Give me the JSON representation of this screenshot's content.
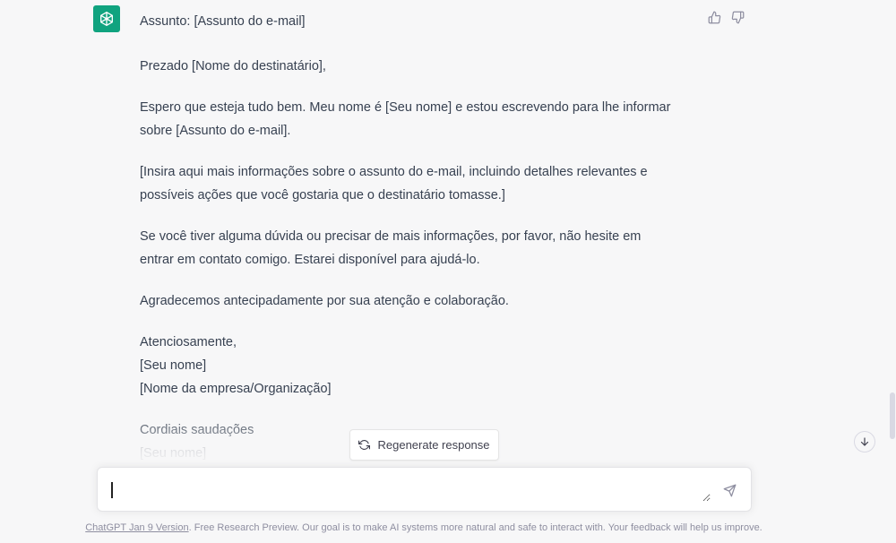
{
  "message": {
    "subject": "Assunto: [Assunto do e-mail]",
    "greeting": "Prezado [Nome do destinatário],",
    "p1_line1": "Espero que esteja tudo bem. Meu nome é [Seu nome] e estou escrevendo para lhe informar",
    "p1_line2": "sobre [Assunto do e-mail].",
    "p2_line1": "[Insira aqui mais informações sobre o assunto do e-mail, incluindo detalhes relevantes e",
    "p2_line2": "possíveis ações que você gostaria que o destinatário tomasse.]",
    "p3_line1": "Se você tiver alguma dúvida ou precisar de mais informações, por favor, não hesite em",
    "p3_line2": "entrar em contato comigo. Estarei disponível para ajudá-lo.",
    "p4": "Agradecemos antecipadamente por sua atenção e colaboração.",
    "closing1": "Atenciosamente,",
    "closing2": "[Seu nome]",
    "closing3": "[Nome da empresa/Organização]",
    "regards": "Cordiais saudações",
    "signature": "[Seu nome]"
  },
  "feedback": {
    "thumbs_up_icon": "thumbs-up-icon",
    "thumbs_down_icon": "thumbs-down-icon"
  },
  "regenerate": {
    "label": "Regenerate response",
    "icon": "refresh-icon"
  },
  "composer": {
    "value": "",
    "placeholder": ""
  },
  "footer": {
    "version_link": "ChatGPT Jan 9 Version",
    "text": ". Free Research Preview. Our goal is to make AI systems more natural and safe to interact with. Your feedback will help us improve."
  },
  "colors": {
    "accent": "#10a37f",
    "background": "#f7f7f8",
    "text": "#374151"
  }
}
